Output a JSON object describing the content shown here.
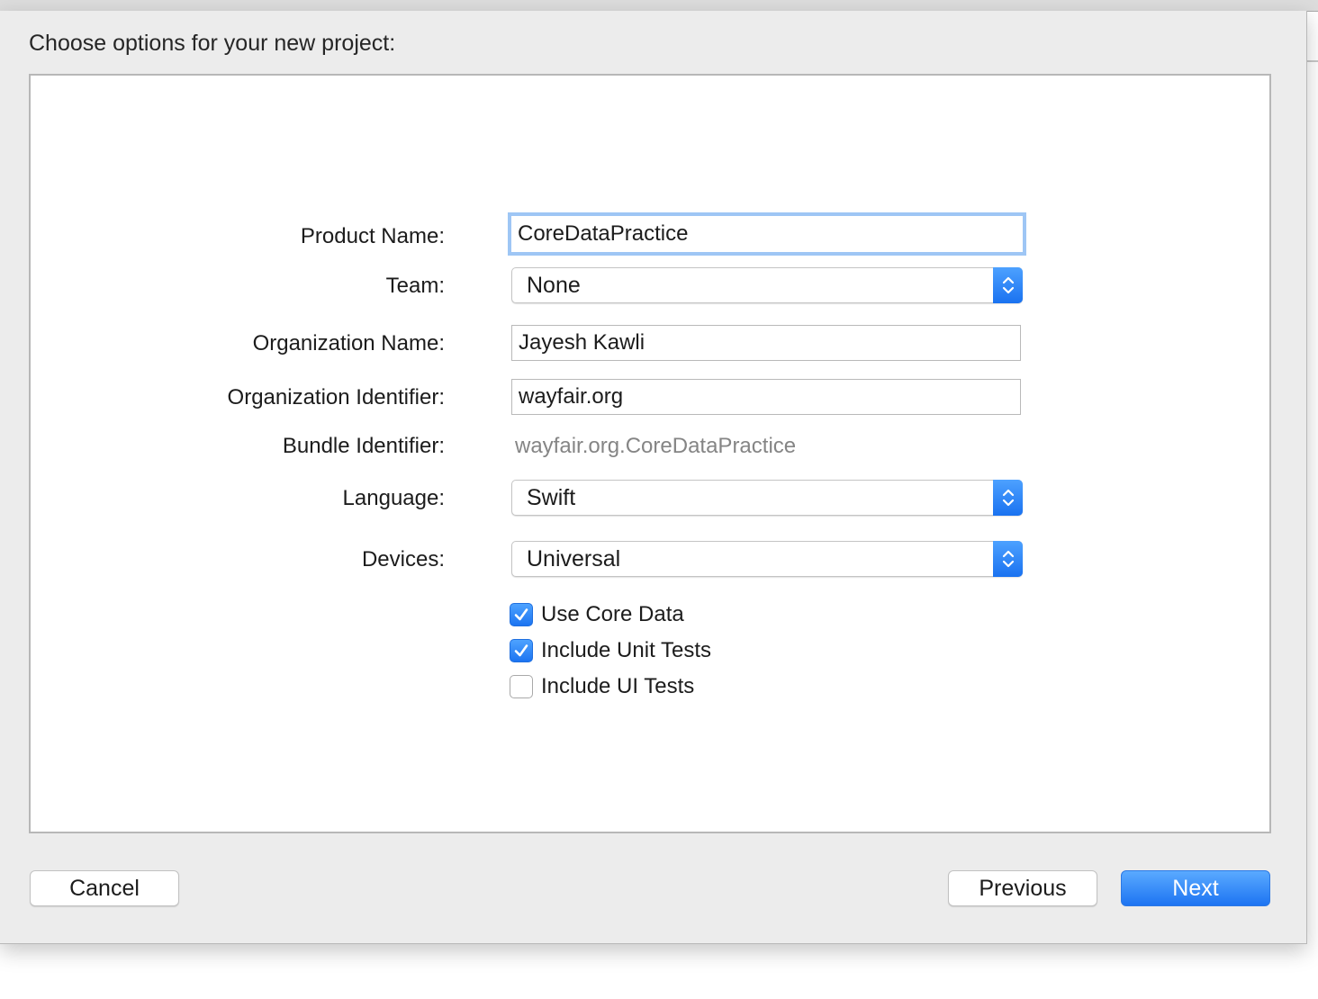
{
  "sheet": {
    "title": "Choose options for your new project:"
  },
  "form": {
    "product_name": {
      "label": "Product Name:",
      "value": "CoreDataPractice"
    },
    "team": {
      "label": "Team:",
      "value": "None"
    },
    "organization_name": {
      "label": "Organization Name:",
      "value": "Jayesh Kawli"
    },
    "organization_identifier": {
      "label": "Organization Identifier:",
      "value": "wayfair.org"
    },
    "bundle_identifier": {
      "label": "Bundle Identifier:",
      "value": "wayfair.org.CoreDataPractice"
    },
    "language": {
      "label": "Language:",
      "value": "Swift"
    },
    "devices": {
      "label": "Devices:",
      "value": "Universal"
    },
    "checkboxes": [
      {
        "label": "Use Core Data",
        "checked": true
      },
      {
        "label": "Include Unit Tests",
        "checked": true
      },
      {
        "label": "Include UI Tests",
        "checked": false
      }
    ]
  },
  "buttons": {
    "cancel": "Cancel",
    "previous": "Previous",
    "next": "Next"
  },
  "colors": {
    "accent": "#1d74f2",
    "focus_ring": "#9ec6f5",
    "sheet_background": "#ececec"
  },
  "icons": {
    "popup_stepper": "chevron-up-down-icon",
    "checkbox_check": "checkmark-icon"
  }
}
